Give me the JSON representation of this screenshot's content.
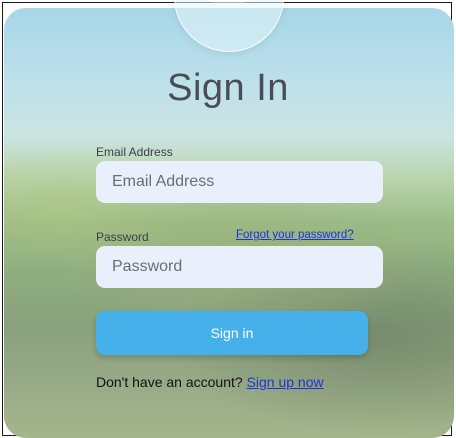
{
  "title": "Sign In",
  "email": {
    "label": "Email Address",
    "placeholder": "Email Address",
    "value": ""
  },
  "password": {
    "label": "Password",
    "placeholder": "Password",
    "value": ""
  },
  "forgot_link": "Forgot your password?",
  "signin_button": "Sign in",
  "signup": {
    "prompt": "Don't have an account?",
    "link": "Sign up now"
  },
  "colors": {
    "primary_button": "#46b0ea",
    "link": "#1a35d9",
    "input_background": "#e9effb",
    "title_text": "#4a4d57"
  },
  "icons": {
    "logo": "logo-icon"
  }
}
